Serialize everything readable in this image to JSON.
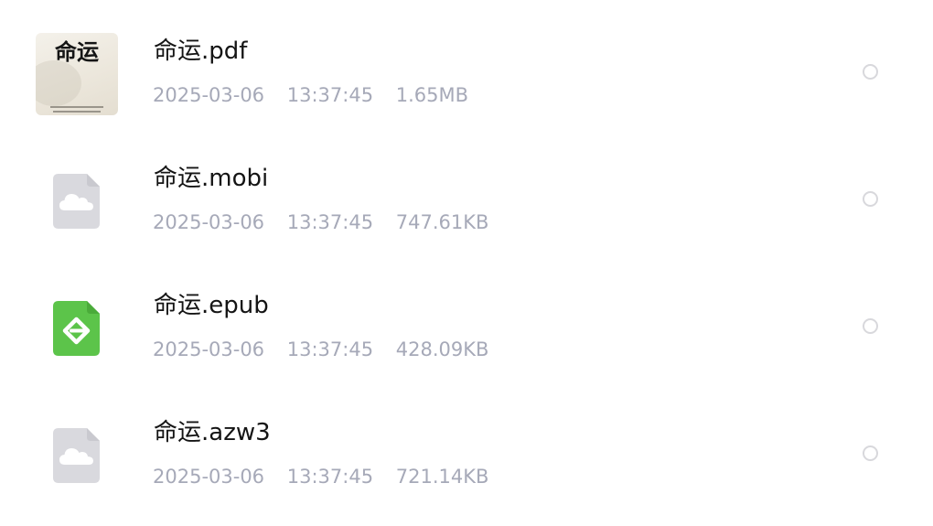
{
  "files": [
    {
      "name": "命运.pdf",
      "date": "2025-03-06",
      "time": "13:37:45",
      "size": "1.65MB",
      "icon": "book-cover-thumbnail",
      "cover_title": "命运"
    },
    {
      "name": "命运.mobi",
      "date": "2025-03-06",
      "time": "13:37:45",
      "size": "747.61KB",
      "icon": "cloud-file-icon"
    },
    {
      "name": "命运.epub",
      "date": "2025-03-06",
      "time": "13:37:45",
      "size": "428.09KB",
      "icon": "epub-file-icon"
    },
    {
      "name": "命运.azw3",
      "date": "2025-03-06",
      "time": "13:37:45",
      "size": "721.14KB",
      "icon": "cloud-file-icon"
    }
  ],
  "colors": {
    "name_text": "#141414",
    "meta_text": "#a6a9b8",
    "cloud_icon_bg": "#d9d9de",
    "epub_icon_bg": "#5cc44a",
    "radio_border": "#d8d8dc"
  }
}
